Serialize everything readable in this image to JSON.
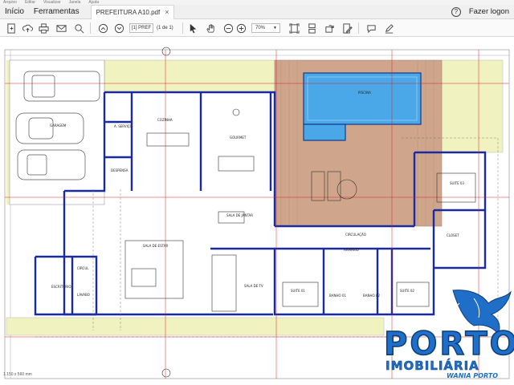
{
  "menubar": {
    "items": [
      "Arquivo",
      "Editar",
      "Visualizar",
      "Janela",
      "Ajuda"
    ]
  },
  "tabbar": {
    "home": "Início",
    "tools": "Ferramentas",
    "document_tab": "PREFEITURA A10.pdf",
    "close": "×",
    "help": "?",
    "login": "Fazer logon"
  },
  "toolbar": {
    "page_input": "[1] PREF",
    "page_count": "(1 de 1)",
    "zoom": "70%"
  },
  "status": {
    "dimensions": "1.150 x 560 mm"
  },
  "plan": {
    "rooms": {
      "garagem": "GARAGEM",
      "area_servico": "A. SERVIÇO",
      "despensa": "DESPENSA",
      "cozinha": "COZINHA",
      "gourmet": "GOURMET",
      "sala_jantar": "SALA DE JANTAR",
      "sala_estar": "SALA DE ESTAR",
      "sala_tv": "SALA DE TV",
      "circulacao": "CIRCULAÇÃO",
      "armario": "ARMÁRIO",
      "piscina": "PISCINA",
      "suite_01": "SUITE 01",
      "suite_02": "SUITE 02",
      "suite_03": "SUITE 03",
      "closet": "CLOSET",
      "escritorio": "ESCRITÓRIO",
      "circul": "CIRCUL",
      "lavabo": "LAVABO",
      "banho_01": "BANHO 01",
      "banho_02": "BANHO 02"
    }
  },
  "logo": {
    "name": "PORTO",
    "subtitle": "IMOBILIÁRIA",
    "owner": "WANIA PORTO"
  },
  "colors": {
    "wall": "#1a2aa0",
    "deck": "#c9a58a",
    "pool": "#4aa8e8",
    "garden": "#e8f0c0",
    "red_line": "#d22",
    "logo_blue": "#1f6fc8"
  }
}
